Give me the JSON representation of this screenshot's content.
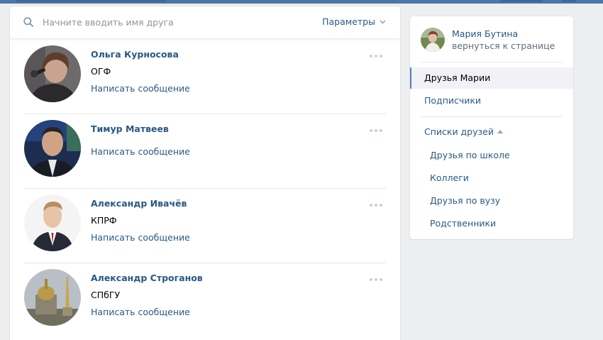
{
  "search": {
    "placeholder": "Начните вводить имя друга",
    "value": "",
    "params_label": "Параметры"
  },
  "friends": [
    {
      "name": "Ольга Курносова",
      "subtitle": "ОГФ",
      "action": "Написать сообщение"
    },
    {
      "name": "Тимур Матвеев",
      "subtitle": "",
      "action": "Написать сообщение"
    },
    {
      "name": "Александр Ивачёв",
      "subtitle": "КПРФ",
      "action": "Написать сообщение"
    },
    {
      "name": "Александр Строганов",
      "subtitle": "СПбГУ",
      "action": "Написать сообщение"
    }
  ],
  "sidebar": {
    "owner_name": "Мария Бутина",
    "back_link": "вернуться к странице",
    "items": [
      {
        "label": "Друзья Марии",
        "active": true
      },
      {
        "label": "Подписчики",
        "active": false
      }
    ],
    "lists_header": "Списки друзей",
    "lists": [
      {
        "label": "Друзья по школе"
      },
      {
        "label": "Коллеги"
      },
      {
        "label": "Друзья по вузу"
      },
      {
        "label": "Родственники"
      }
    ]
  },
  "colors": {
    "accent": "#4a76a8",
    "link": "#2a5885",
    "page_bg": "#edeef0",
    "active_bar": "#5181b8"
  },
  "icons": {
    "search": "search-icon",
    "params": "chevron-down-icon",
    "more": "more-dots-icon",
    "lists": "caret-up-icon"
  }
}
